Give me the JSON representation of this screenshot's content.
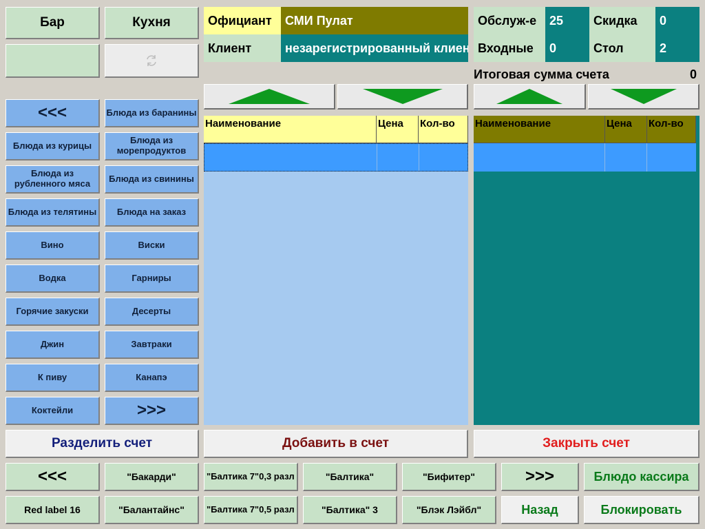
{
  "top_buttons": {
    "bar": "Бар",
    "kitchen": "Кухня"
  },
  "categories": {
    "prev": "<<<",
    "next": ">>>",
    "items": [
      "Блюда из баранины",
      "Блюда из курицы",
      "Блюда из морепродуктов",
      "Блюда из рубленного мяса",
      "Блюда из свинины",
      "Блюда из телятины",
      "Блюда на заказ",
      "Вино",
      "Виски",
      "Водка",
      "Гарниры",
      "Горячие закуски",
      "Десерты",
      "Джин",
      "Завтраки",
      "К пиву",
      "Канапэ",
      "Коктейли"
    ]
  },
  "info": {
    "waiter_label": "Официант",
    "waiter_value": "СМИ Пулат",
    "client_label": "Клиент",
    "client_value": "незарегистрированный клиент",
    "service_label": "Обслуж-е",
    "service_value": "25",
    "discount_label": "Скидка",
    "discount_value": "0",
    "entry_label": "Входные",
    "entry_value": "0",
    "table_label": "Стол",
    "table_value": "2"
  },
  "total": {
    "label": "Итоговая сумма счета",
    "value": "0"
  },
  "order_table": {
    "col_name": "Наименование",
    "col_price": "Цена",
    "col_qty": "Кол-во"
  },
  "bill_table": {
    "col_name": "Наименование",
    "col_price": "Цена",
    "col_qty": "Кол-во"
  },
  "actions": {
    "split": "Разделить счет",
    "add": "Добавить в счет",
    "close": "Закрыть счет"
  },
  "products": {
    "prev": "<<<",
    "next": ">>>",
    "row1": [
      "\"Бакарди\"",
      "\"Балтика 7\"0,3 разл",
      "\"Балтика\"",
      "\"Бифитер\""
    ],
    "row2": [
      "Red label 16",
      "\"Балантайнс\"",
      "\"Балтика 7\"0,5 разл",
      "\"Балтика\" 3",
      "\"Блэк Лэйбл\""
    ]
  },
  "bottom": {
    "cashier_dish": "Блюдо кассира",
    "back": "Назад",
    "lock": "Блокировать"
  },
  "colors": {
    "olive": "#7f7b00",
    "teal": "#0b8080",
    "yellow": "#ffff99",
    "light_blue": "#a6caf0",
    "selection_blue": "#3d9bff",
    "arrow_green": "#0e9a1f",
    "split_text": "#121e7a",
    "add_text": "#7a1010",
    "close_text": "#e11d1d",
    "action_green": "#0a7a1a"
  }
}
